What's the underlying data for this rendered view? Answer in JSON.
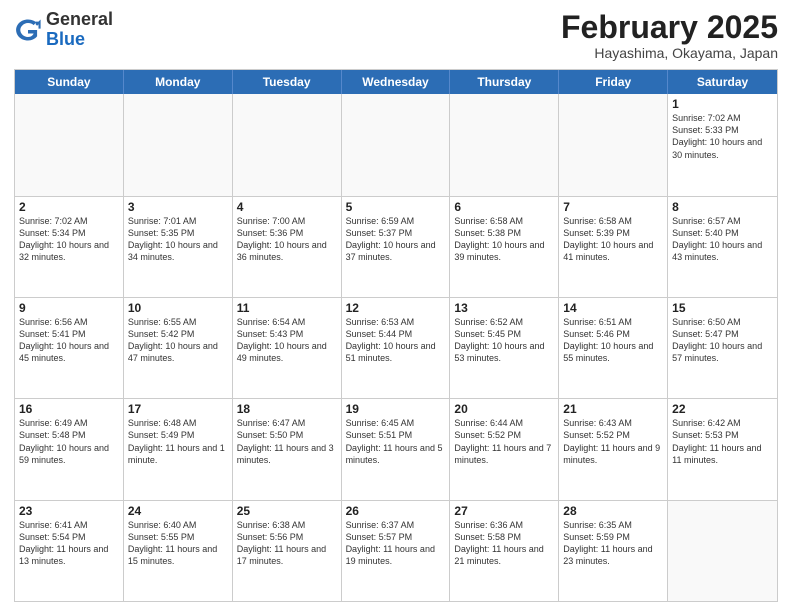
{
  "header": {
    "logo_general": "General",
    "logo_blue": "Blue",
    "month_title": "February 2025",
    "location": "Hayashima, Okayama, Japan"
  },
  "days_of_week": [
    "Sunday",
    "Monday",
    "Tuesday",
    "Wednesday",
    "Thursday",
    "Friday",
    "Saturday"
  ],
  "weeks": [
    [
      {
        "day": "",
        "empty": true
      },
      {
        "day": "",
        "empty": true
      },
      {
        "day": "",
        "empty": true
      },
      {
        "day": "",
        "empty": true
      },
      {
        "day": "",
        "empty": true
      },
      {
        "day": "",
        "empty": true
      },
      {
        "day": "1",
        "sunrise": "Sunrise: 7:02 AM",
        "sunset": "Sunset: 5:33 PM",
        "daylight": "Daylight: 10 hours and 30 minutes."
      }
    ],
    [
      {
        "day": "2",
        "sunrise": "Sunrise: 7:02 AM",
        "sunset": "Sunset: 5:34 PM",
        "daylight": "Daylight: 10 hours and 32 minutes."
      },
      {
        "day": "3",
        "sunrise": "Sunrise: 7:01 AM",
        "sunset": "Sunset: 5:35 PM",
        "daylight": "Daylight: 10 hours and 34 minutes."
      },
      {
        "day": "4",
        "sunrise": "Sunrise: 7:00 AM",
        "sunset": "Sunset: 5:36 PM",
        "daylight": "Daylight: 10 hours and 36 minutes."
      },
      {
        "day": "5",
        "sunrise": "Sunrise: 6:59 AM",
        "sunset": "Sunset: 5:37 PM",
        "daylight": "Daylight: 10 hours and 37 minutes."
      },
      {
        "day": "6",
        "sunrise": "Sunrise: 6:58 AM",
        "sunset": "Sunset: 5:38 PM",
        "daylight": "Daylight: 10 hours and 39 minutes."
      },
      {
        "day": "7",
        "sunrise": "Sunrise: 6:58 AM",
        "sunset": "Sunset: 5:39 PM",
        "daylight": "Daylight: 10 hours and 41 minutes."
      },
      {
        "day": "8",
        "sunrise": "Sunrise: 6:57 AM",
        "sunset": "Sunset: 5:40 PM",
        "daylight": "Daylight: 10 hours and 43 minutes."
      }
    ],
    [
      {
        "day": "9",
        "sunrise": "Sunrise: 6:56 AM",
        "sunset": "Sunset: 5:41 PM",
        "daylight": "Daylight: 10 hours and 45 minutes."
      },
      {
        "day": "10",
        "sunrise": "Sunrise: 6:55 AM",
        "sunset": "Sunset: 5:42 PM",
        "daylight": "Daylight: 10 hours and 47 minutes."
      },
      {
        "day": "11",
        "sunrise": "Sunrise: 6:54 AM",
        "sunset": "Sunset: 5:43 PM",
        "daylight": "Daylight: 10 hours and 49 minutes."
      },
      {
        "day": "12",
        "sunrise": "Sunrise: 6:53 AM",
        "sunset": "Sunset: 5:44 PM",
        "daylight": "Daylight: 10 hours and 51 minutes."
      },
      {
        "day": "13",
        "sunrise": "Sunrise: 6:52 AM",
        "sunset": "Sunset: 5:45 PM",
        "daylight": "Daylight: 10 hours and 53 minutes."
      },
      {
        "day": "14",
        "sunrise": "Sunrise: 6:51 AM",
        "sunset": "Sunset: 5:46 PM",
        "daylight": "Daylight: 10 hours and 55 minutes."
      },
      {
        "day": "15",
        "sunrise": "Sunrise: 6:50 AM",
        "sunset": "Sunset: 5:47 PM",
        "daylight": "Daylight: 10 hours and 57 minutes."
      }
    ],
    [
      {
        "day": "16",
        "sunrise": "Sunrise: 6:49 AM",
        "sunset": "Sunset: 5:48 PM",
        "daylight": "Daylight: 10 hours and 59 minutes."
      },
      {
        "day": "17",
        "sunrise": "Sunrise: 6:48 AM",
        "sunset": "Sunset: 5:49 PM",
        "daylight": "Daylight: 11 hours and 1 minute."
      },
      {
        "day": "18",
        "sunrise": "Sunrise: 6:47 AM",
        "sunset": "Sunset: 5:50 PM",
        "daylight": "Daylight: 11 hours and 3 minutes."
      },
      {
        "day": "19",
        "sunrise": "Sunrise: 6:45 AM",
        "sunset": "Sunset: 5:51 PM",
        "daylight": "Daylight: 11 hours and 5 minutes."
      },
      {
        "day": "20",
        "sunrise": "Sunrise: 6:44 AM",
        "sunset": "Sunset: 5:52 PM",
        "daylight": "Daylight: 11 hours and 7 minutes."
      },
      {
        "day": "21",
        "sunrise": "Sunrise: 6:43 AM",
        "sunset": "Sunset: 5:52 PM",
        "daylight": "Daylight: 11 hours and 9 minutes."
      },
      {
        "day": "22",
        "sunrise": "Sunrise: 6:42 AM",
        "sunset": "Sunset: 5:53 PM",
        "daylight": "Daylight: 11 hours and 11 minutes."
      }
    ],
    [
      {
        "day": "23",
        "sunrise": "Sunrise: 6:41 AM",
        "sunset": "Sunset: 5:54 PM",
        "daylight": "Daylight: 11 hours and 13 minutes."
      },
      {
        "day": "24",
        "sunrise": "Sunrise: 6:40 AM",
        "sunset": "Sunset: 5:55 PM",
        "daylight": "Daylight: 11 hours and 15 minutes."
      },
      {
        "day": "25",
        "sunrise": "Sunrise: 6:38 AM",
        "sunset": "Sunset: 5:56 PM",
        "daylight": "Daylight: 11 hours and 17 minutes."
      },
      {
        "day": "26",
        "sunrise": "Sunrise: 6:37 AM",
        "sunset": "Sunset: 5:57 PM",
        "daylight": "Daylight: 11 hours and 19 minutes."
      },
      {
        "day": "27",
        "sunrise": "Sunrise: 6:36 AM",
        "sunset": "Sunset: 5:58 PM",
        "daylight": "Daylight: 11 hours and 21 minutes."
      },
      {
        "day": "28",
        "sunrise": "Sunrise: 6:35 AM",
        "sunset": "Sunset: 5:59 PM",
        "daylight": "Daylight: 11 hours and 23 minutes."
      },
      {
        "day": "",
        "empty": true
      }
    ]
  ]
}
